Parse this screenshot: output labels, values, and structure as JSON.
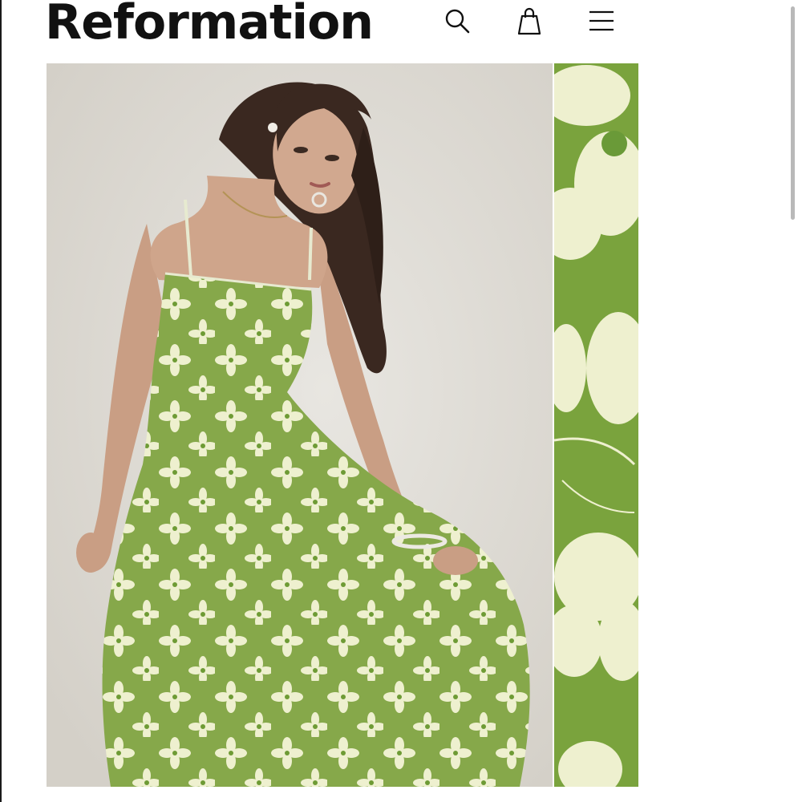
{
  "header": {
    "brand": "Reformation",
    "icons": [
      "search-icon",
      "shopping-bag-icon",
      "hamburger-menu-icon"
    ]
  },
  "colors": {
    "background": "#ffffff",
    "text": "#111111",
    "dress_green": "#86a84a",
    "flower_cream": "#eef0cf",
    "photo_backdrop": "#e1ded8"
  },
  "gallery": {
    "main_image": "product-photo-model-green-floral-dress",
    "detail_image": "fabric-print-closeup"
  }
}
